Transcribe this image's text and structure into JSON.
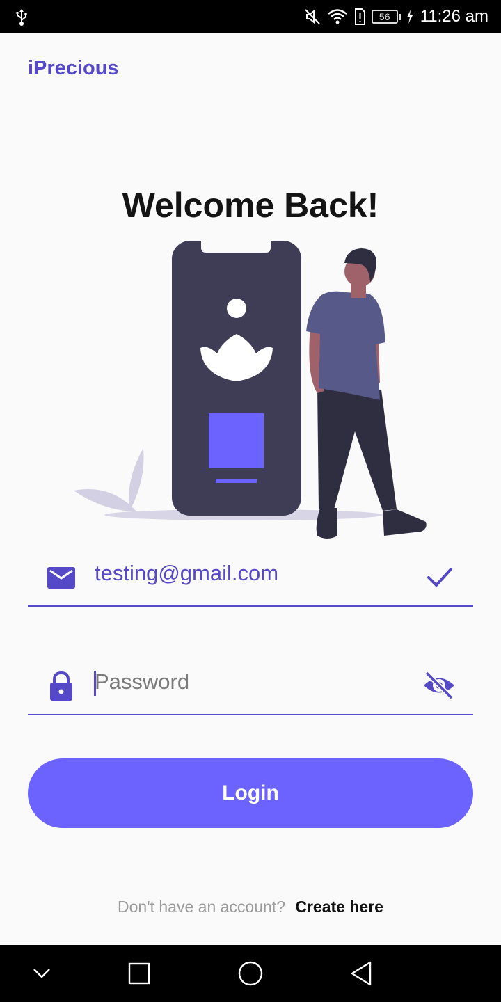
{
  "status_bar": {
    "battery_level": "56",
    "time": "11:26 am",
    "icons": [
      "usb-icon",
      "mute-icon",
      "wifi-icon",
      "alert-icon",
      "battery-icon",
      "charging-icon"
    ]
  },
  "header": {
    "app_title": "iPrecious"
  },
  "main": {
    "heading": "Welcome Back!"
  },
  "form": {
    "email": {
      "value": "testing@gmail.com",
      "icon": "mail-icon",
      "trailing_icon": "check-icon"
    },
    "password": {
      "value": "",
      "placeholder": "Password",
      "icon": "lock-icon",
      "trailing_icon": "visibility-off-icon"
    },
    "login_label": "Login"
  },
  "footer": {
    "question": "Don't have an account?",
    "create_link": "Create here"
  },
  "colors": {
    "accent": "#5649c8",
    "button": "#6c63ff",
    "background": "#fafafa",
    "phone": "#3f3d56"
  },
  "nav_bar": {
    "icons": [
      "collapse-icon",
      "recents-icon",
      "home-icon",
      "back-icon"
    ]
  }
}
